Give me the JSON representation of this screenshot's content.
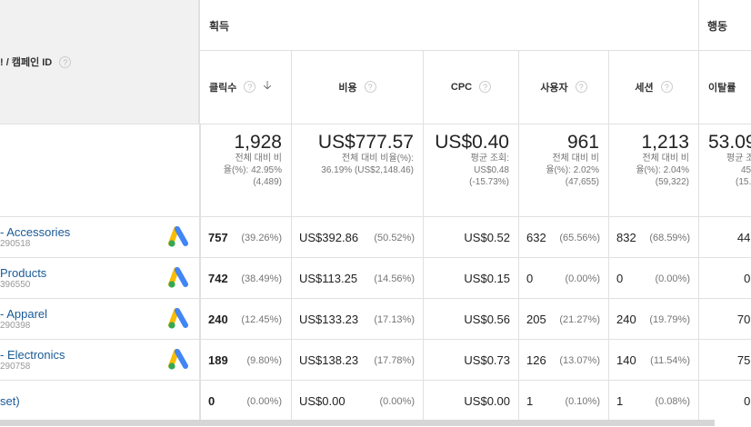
{
  "header": {
    "dimension_label": "! / 캠페인 ID",
    "group_acquisition": "획득",
    "group_behavior": "행동"
  },
  "columns": {
    "clicks": "클릭수",
    "cost": "비용",
    "cpc": "CPC",
    "users": "사용자",
    "sessions": "세션",
    "bounce": "이탈률"
  },
  "totals": {
    "clicks": {
      "value": "1,928",
      "sub1": "전체 대비 비",
      "sub2": "율(%): 42.95%",
      "sub3": "(4,489)"
    },
    "cost": {
      "value": "US$777.57",
      "sub1": "전체 대비 비율(%):",
      "sub2": "36.19% (US$2,148.46)"
    },
    "cpc": {
      "value": "US$0.40",
      "sub1": "평균 조회:",
      "sub2": "US$0.48",
      "sub3": "(-15.73%)"
    },
    "users": {
      "value": "961",
      "sub1": "전체 대비 비",
      "sub2": "율(%): 2.02%",
      "sub3": "(47,655)"
    },
    "sessions": {
      "value": "1,213",
      "sub1": "전체 대비 비",
      "sub2": "율(%): 2.04%",
      "sub3": "(59,322)"
    },
    "bounce": {
      "value": "53.09",
      "sub1": "평균 조",
      "sub2": "45",
      "sub3": "(15.8"
    }
  },
  "rows": [
    {
      "name": "- Accessories",
      "id": "290518",
      "clicks": "757",
      "clicks_pct": "(39.26%)",
      "cost": "US$392.86",
      "cost_pct": "(50.52%)",
      "cpc": "US$0.52",
      "users": "632",
      "users_pct": "(65.56%)",
      "sessions": "832",
      "sessions_pct": "(68.59%)",
      "bounce": "44."
    },
    {
      "name": "Products",
      "id": "396550",
      "clicks": "742",
      "clicks_pct": "(38.49%)",
      "cost": "US$113.25",
      "cost_pct": "(14.56%)",
      "cpc": "US$0.15",
      "users": "0",
      "users_pct": "(0.00%)",
      "sessions": "0",
      "sessions_pct": "(0.00%)",
      "bounce": "0."
    },
    {
      "name": "- Apparel",
      "id": "290398",
      "clicks": "240",
      "clicks_pct": "(12.45%)",
      "cost": "US$133.23",
      "cost_pct": "(17.13%)",
      "cpc": "US$0.56",
      "users": "205",
      "users_pct": "(21.27%)",
      "sessions": "240",
      "sessions_pct": "(19.79%)",
      "bounce": "70."
    },
    {
      "name": "- Electronics",
      "id": "290758",
      "clicks": "189",
      "clicks_pct": "(9.80%)",
      "cost": "US$138.23",
      "cost_pct": "(17.78%)",
      "cpc": "US$0.73",
      "users": "126",
      "users_pct": "(13.07%)",
      "sessions": "140",
      "sessions_pct": "(11.54%)",
      "bounce": "75."
    },
    {
      "name": "set)",
      "id": "",
      "clicks": "0",
      "clicks_pct": "(0.00%)",
      "cost": "US$0.00",
      "cost_pct": "(0.00%)",
      "cpc": "US$0.00",
      "users": "1",
      "users_pct": "(0.10%)",
      "sessions": "1",
      "sessions_pct": "(0.08%)",
      "bounce": "0."
    }
  ],
  "icons": {
    "help": "help-icon",
    "sort": "sort-down-arrow-icon",
    "ads": "google-ads-icon"
  },
  "colors": {
    "link": "#1a5a96",
    "header_bg": "#f1f1f1",
    "ads_blue": "#4285f4",
    "ads_yellow": "#fbbc04",
    "ads_green": "#34a853"
  }
}
